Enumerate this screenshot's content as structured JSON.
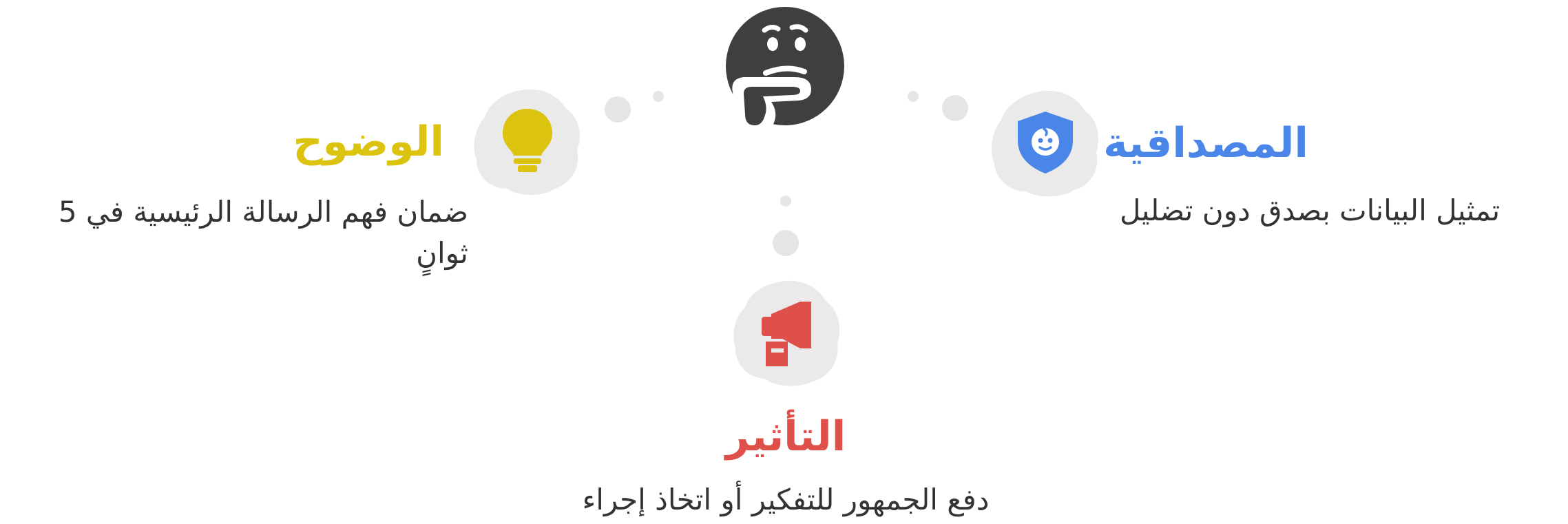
{
  "colors": {
    "credibility": "#4a86e8",
    "clarity": "#dbc310",
    "impact": "#e0504a",
    "center_face": "#3f3f3f",
    "blob": "#eaeaea",
    "text": "#333333"
  },
  "center": {
    "icon": "thinking-face-icon"
  },
  "credibility": {
    "icon": "shield-face-icon",
    "title": "المصداقية",
    "description": "تمثيل البيانات بصدق دون تضليل"
  },
  "clarity": {
    "icon": "lightbulb-icon",
    "title": "الوضوح",
    "description": "ضمان فهم الرسالة الرئيسية في 5 ثوانٍ"
  },
  "impact": {
    "icon": "megaphone-icon",
    "title": "التأثير",
    "description": "دفع الجمهور للتفكير أو اتخاذ إجراء"
  }
}
